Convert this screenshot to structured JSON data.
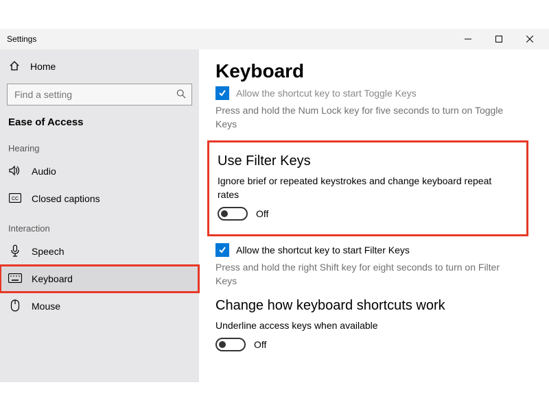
{
  "window": {
    "title": "Settings"
  },
  "nav": {
    "home_label": "Home",
    "search_placeholder": "Find a setting",
    "section_title": "Ease of Access",
    "groups": {
      "hearing_header": "Hearing",
      "interaction_header": "Interaction"
    },
    "items": {
      "audio": "Audio",
      "captions": "Closed captions",
      "speech": "Speech",
      "keyboard": "Keyboard",
      "mouse": "Mouse"
    }
  },
  "content": {
    "page_title": "Keyboard",
    "toggle_keys": {
      "checkbox_label": "Allow the shortcut key to start Toggle Keys",
      "description": "Press and hold the Num Lock key for five seconds to turn on Toggle Keys"
    },
    "filter_keys": {
      "heading": "Use Filter Keys",
      "description": "Ignore brief or repeated keystrokes and change keyboard repeat rates",
      "toggle_state": "Off"
    },
    "filter_shortcut": {
      "checkbox_label": "Allow the shortcut key to start Filter Keys",
      "description": "Press and hold the right Shift key for eight seconds to turn on Filter Keys"
    },
    "shortcuts_section": {
      "heading": "Change how keyboard shortcuts work",
      "underline_label": "Underline access keys when available",
      "underline_state": "Off"
    }
  }
}
